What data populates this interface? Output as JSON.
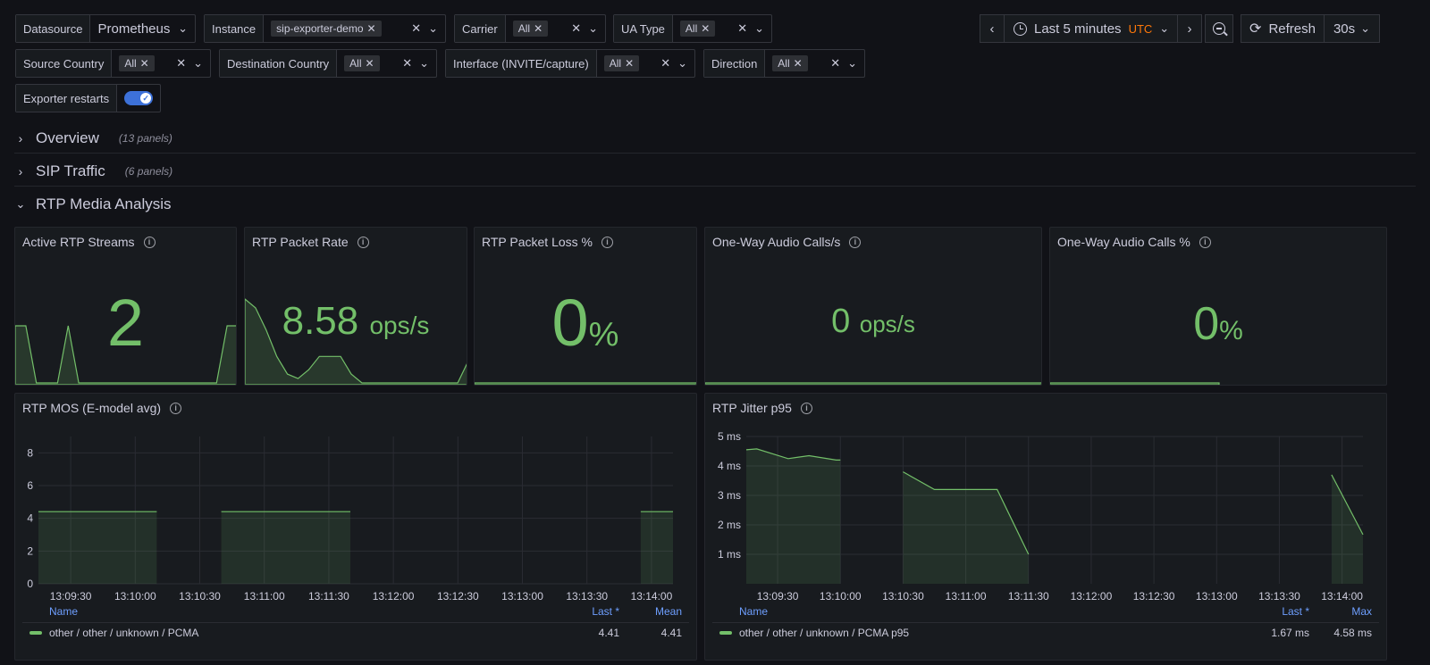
{
  "variables": {
    "datasource": {
      "label": "Datasource",
      "value": "Prometheus"
    },
    "instance": {
      "label": "Instance",
      "chip": "sip-exporter-demo"
    },
    "carrier": {
      "label": "Carrier",
      "chip": "All"
    },
    "ua_type": {
      "label": "UA Type",
      "chip": "All"
    },
    "source_country": {
      "label": "Source Country",
      "chip": "All"
    },
    "destination_country": {
      "label": "Destination Country",
      "chip": "All"
    },
    "interface": {
      "label": "Interface (INVITE/capture)",
      "chip": "All"
    },
    "direction": {
      "label": "Direction",
      "chip": "All"
    },
    "exporter_restarts": {
      "label": "Exporter restarts",
      "enabled": true
    }
  },
  "time_controls": {
    "range": "Last 5 minutes",
    "timezone": "UTC",
    "refresh_label": "Refresh",
    "refresh_interval": "30s"
  },
  "rows": [
    {
      "title": "Overview",
      "count": "(13 panels)",
      "collapsed": true
    },
    {
      "title": "SIP Traffic",
      "count": "(6 panels)",
      "collapsed": true
    },
    {
      "title": "RTP Media Analysis",
      "collapsed": false
    }
  ],
  "stats": [
    {
      "title": "Active RTP Streams",
      "value": "2",
      "unit": "",
      "spark": [
        2,
        2,
        0,
        0,
        0,
        2,
        0,
        0,
        0,
        0,
        0,
        0,
        0,
        0,
        0,
        0,
        0,
        0,
        0,
        0,
        2,
        2
      ]
    },
    {
      "title": "RTP Packet Rate",
      "value": "8.58",
      "unit": "ops/s",
      "spark": [
        9.5,
        8.5,
        6,
        3,
        1,
        0.5,
        1.5,
        3,
        3,
        3,
        1,
        0,
        0,
        0,
        0,
        0,
        0,
        0,
        0,
        0,
        0,
        2.5
      ]
    },
    {
      "title": "RTP Packet Loss %",
      "value": "0",
      "unit": "%",
      "spark": [
        0,
        0
      ]
    },
    {
      "title": "One-Way Audio Calls/s",
      "value": "0",
      "unit": "ops/s",
      "spark": [
        0,
        0
      ]
    },
    {
      "title": "One-Way Audio Calls %",
      "value": "0",
      "unit": "%",
      "spark": [
        0,
        0
      ]
    }
  ],
  "chart_data": [
    {
      "type": "area",
      "title": "RTP MOS (E-model avg)",
      "x_ticks": [
        "13:09:30",
        "13:10:00",
        "13:10:30",
        "13:11:00",
        "13:11:30",
        "13:12:00",
        "13:12:30",
        "13:13:00",
        "13:13:30",
        "13:14:00"
      ],
      "y_ticks": [
        "0",
        "2",
        "4",
        "6",
        "8"
      ],
      "ylim": [
        0,
        9
      ],
      "series": [
        {
          "name": "other / other / unknown / PCMA",
          "segments": [
            [
              [
                "13:09:15",
                4.41
              ],
              [
                "13:10:10",
                4.41
              ]
            ],
            [
              [
                "13:10:40",
                4.41
              ],
              [
                "13:11:40",
                4.41
              ]
            ],
            [
              [
                "13:13:55",
                4.41
              ],
              [
                "13:14:10",
                4.41
              ]
            ]
          ]
        }
      ],
      "legend": {
        "name_header": "Name",
        "col1_header": "Last *",
        "col2_header": "Mean",
        "rows": [
          {
            "name": "other / other / unknown / PCMA",
            "col1": "4.41",
            "col2": "4.41",
            "color": "#73bf69"
          }
        ]
      }
    },
    {
      "type": "area",
      "title": "RTP Jitter p95",
      "x_ticks": [
        "13:09:30",
        "13:10:00",
        "13:10:30",
        "13:11:00",
        "13:11:30",
        "13:12:00",
        "13:12:30",
        "13:13:00",
        "13:13:30",
        "13:14:00"
      ],
      "y_ticks": [
        "1 ms",
        "2 ms",
        "3 ms",
        "4 ms",
        "5 ms"
      ],
      "ylim": [
        0,
        5
      ],
      "series": [
        {
          "name": "other / other / unknown / PCMA p95",
          "segments": [
            [
              [
                "13:09:15",
                4.55
              ],
              [
                "13:09:20",
                4.58
              ],
              [
                "13:09:35",
                4.25
              ],
              [
                "13:09:45",
                4.35
              ],
              [
                "13:09:58",
                4.2
              ],
              [
                "13:10:00",
                4.2
              ]
            ],
            [
              [
                "13:10:30",
                3.8
              ],
              [
                "13:10:45",
                3.2
              ],
              [
                "13:11:00",
                3.2
              ],
              [
                "13:11:15",
                3.2
              ],
              [
                "13:11:30",
                1.0
              ]
            ],
            [
              [
                "13:13:55",
                3.7
              ],
              [
                "13:14:10",
                1.67
              ]
            ]
          ]
        }
      ],
      "legend": {
        "name_header": "Name",
        "col1_header": "Last *",
        "col2_header": "Max",
        "rows": [
          {
            "name": "other / other / unknown / PCMA p95",
            "col1": "1.67 ms",
            "col2": "4.58 ms",
            "color": "#73bf69"
          }
        ]
      }
    }
  ]
}
